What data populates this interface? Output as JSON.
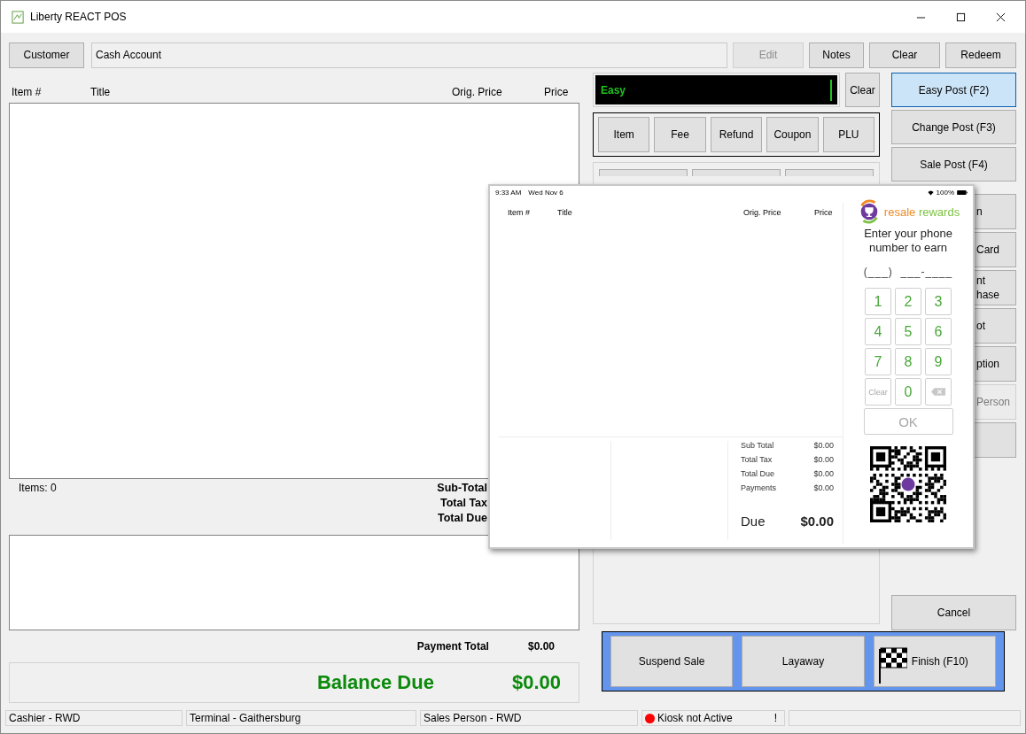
{
  "window": {
    "title": "Liberty REACT POS"
  },
  "customer_bar": {
    "customer_button": "Customer",
    "account": "Cash Account",
    "buttons": [
      {
        "label": "Edit",
        "disabled": true
      },
      {
        "label": "Notes",
        "disabled": false
      },
      {
        "label": "Clear",
        "disabled": false
      },
      {
        "label": "Redeem",
        "disabled": false
      }
    ]
  },
  "item_table": {
    "columns": [
      "Item #",
      "Title",
      "Orig. Price",
      "Price"
    ]
  },
  "items_count": "Items: 0",
  "totals": [
    "Sub-Total",
    "Total Tax",
    "Total Due"
  ],
  "payment_total": {
    "label": "Payment Total",
    "value": "$0.00"
  },
  "balance_due": {
    "label": "Balance Due",
    "value": "$0.00"
  },
  "entry": {
    "value": "Easy",
    "clear": "Clear"
  },
  "entry_types": [
    "Item",
    "Fee",
    "Refund",
    "Coupon",
    "PLU"
  ],
  "post_modes": [
    {
      "label": "Easy Post (F2)",
      "selected": true
    },
    {
      "label": "Change Post (F3)",
      "selected": false
    },
    {
      "label": "Sale Post (F4)",
      "selected": false
    }
  ],
  "side_buttons": [
    {
      "lines": [
        "n"
      ],
      "disabled": false
    },
    {
      "lines": [
        "Card"
      ],
      "disabled": false
    },
    {
      "lines": [
        "nt",
        "hase"
      ],
      "disabled": false
    },
    {
      "lines": [
        "ot"
      ],
      "disabled": false
    },
    {
      "lines": [
        "ption"
      ],
      "disabled": false
    },
    {
      "lines": [
        "Person"
      ],
      "disabled": true
    },
    {
      "disabled": false
    }
  ],
  "cancel": "Cancel",
  "action_bar": [
    {
      "label": "Suspend Sale",
      "kind": "plain"
    },
    {
      "label": "Layaway",
      "kind": "plain"
    },
    {
      "label": "Finish (F10)",
      "kind": "flag"
    }
  ],
  "status_bar": [
    {
      "kind": "text",
      "text": "Cashier - RWD"
    },
    {
      "kind": "text",
      "text": "Terminal - Gaithersburg"
    },
    {
      "kind": "text",
      "text": "Sales Person - RWD"
    },
    {
      "kind": "kiosk",
      "text": "Kiosk not Active",
      "color": "#ff0000",
      "alert": "!"
    },
    {
      "kind": "empty"
    }
  ],
  "kiosk_display": {
    "time": "9:33 AM",
    "date": "Wed Nov 6",
    "battery": "100%",
    "columns": [
      "Item #",
      "Title",
      "Orig. Price",
      "Price"
    ],
    "totals": [
      {
        "label": "Sub Total",
        "value": "$0.00"
      },
      {
        "label": "Total Tax",
        "value": "$0.00"
      },
      {
        "label": "Total Due",
        "value": "$0.00"
      },
      {
        "label": "Payments",
        "value": "$0.00"
      }
    ],
    "due": {
      "label": "Due",
      "value": "$0.00"
    },
    "brand": {
      "word_1": "resale",
      "word_2": "rewards"
    },
    "prompt": "Enter your phone number to earn",
    "phone_mask": "(___)  ___-____",
    "keys": [
      {
        "kind": "digit",
        "label": "1",
        "disabled": false
      },
      {
        "kind": "digit",
        "label": "2",
        "disabled": false
      },
      {
        "kind": "digit",
        "label": "3",
        "disabled": false
      },
      {
        "kind": "digit",
        "label": "4",
        "disabled": false
      },
      {
        "kind": "digit",
        "label": "5",
        "disabled": false
      },
      {
        "kind": "digit",
        "label": "6",
        "disabled": false
      },
      {
        "kind": "digit",
        "label": "7",
        "disabled": false
      },
      {
        "kind": "digit",
        "label": "8",
        "disabled": false
      },
      {
        "kind": "digit",
        "label": "9",
        "disabled": false
      },
      {
        "kind": "clear",
        "label": "Clear",
        "disabled": true
      },
      {
        "kind": "digit",
        "label": "0",
        "disabled": false
      },
      {
        "kind": "backspace",
        "disabled": true
      }
    ],
    "ok": {
      "label": "OK",
      "disabled": true
    }
  }
}
